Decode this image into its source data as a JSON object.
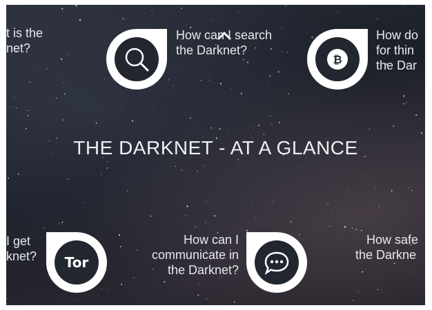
{
  "title": "THE DARKNET - AT A GLANCE",
  "cards": {
    "top_left": {
      "line1": "t is the",
      "line2": "net?"
    },
    "top_search": {
      "line1": "How can I search",
      "line2": "the Darknet?",
      "icon": "magnifier-icon"
    },
    "top_right": {
      "line1": "How do",
      "line2": "for thin",
      "line3": "the Dar",
      "icon": "bitcoin-icon"
    },
    "bottom_left": {
      "line1": "I get",
      "line2": "knet?",
      "icon": "tor-icon",
      "icon_text": "Tor"
    },
    "bottom_communicate": {
      "line1": "How can I",
      "line2": "communicate in",
      "line3": "the Darknet?",
      "icon": "chat-bubble-icon"
    },
    "bottom_right": {
      "line1": "How safe",
      "line2": "the Darkne"
    }
  },
  "colors": {
    "background": "#1f232c",
    "badge": "#ffffff",
    "text": "#e6e9ef"
  }
}
